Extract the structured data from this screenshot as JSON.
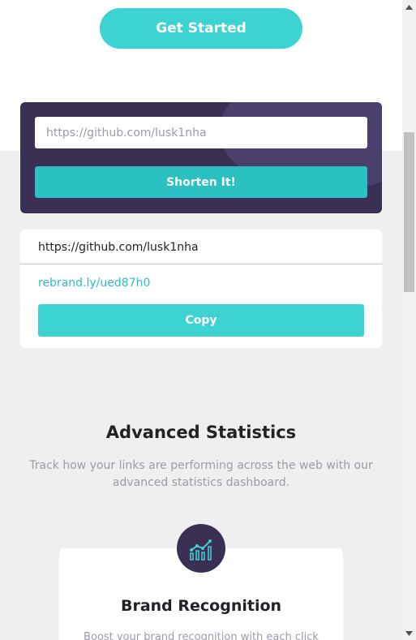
{
  "hero": {
    "get_started_label": "Get Started"
  },
  "shortener": {
    "input_value": "https://github.com/lusk1nha",
    "button_label": "Shorten It!"
  },
  "result": {
    "original_url": "https://github.com/lusk1nha",
    "short_url": "rebrand.ly/ued87h0",
    "copy_label": "Copy"
  },
  "stats": {
    "title": "Advanced Statistics",
    "description": "Track how your links are performing across the web with our advanced statistics dashboard."
  },
  "feature": {
    "icon": "brand-recognition-chart-icon",
    "title": "Brand Recognition",
    "description": "Boost your brand recognition with each click"
  },
  "colors": {
    "cyan": "#3ed3d3",
    "dark_violet": "#3b3054",
    "gray_text": "#9e9aa7",
    "dark_text": "#232127",
    "background": "#efefef"
  }
}
